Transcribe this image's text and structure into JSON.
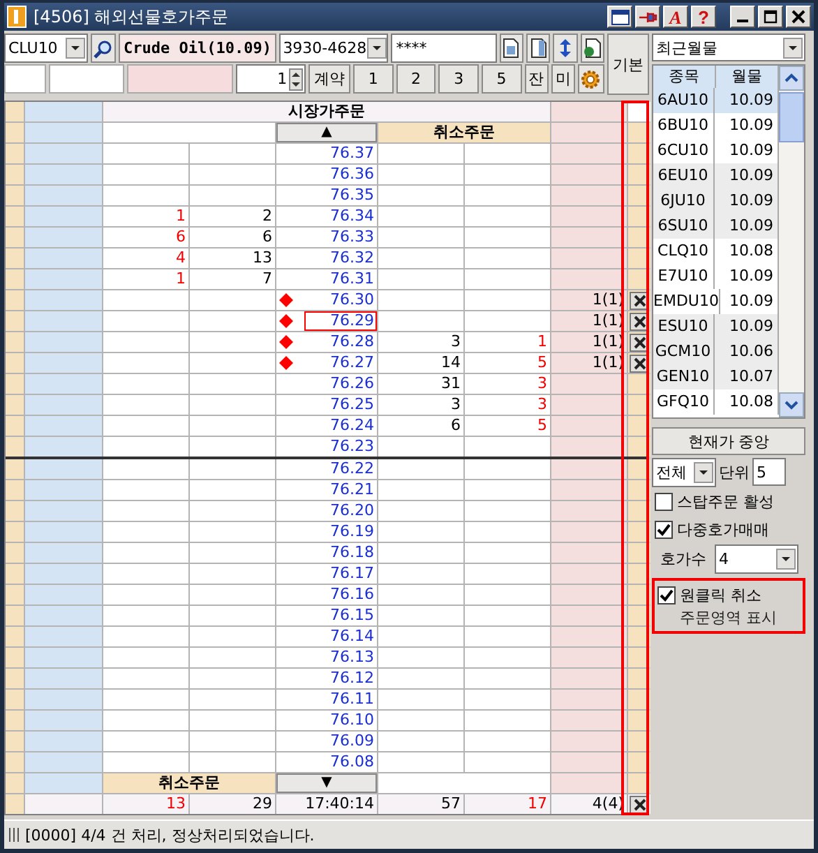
{
  "window": {
    "title": "[4506] 해외선물호가주문",
    "font_button": "A",
    "help_button": "?"
  },
  "toolbar": {
    "symbol": "CLU10",
    "instrument_name": "Crude Oil(10.09)",
    "account": "3930-4628",
    "password": "****",
    "quantity": "1",
    "quantity_button": "계약",
    "quick_quantities": [
      "1",
      "2",
      "3",
      "5"
    ],
    "balance_button": "잔",
    "unfilled_button": "미",
    "default_button": "기본"
  },
  "order_book": {
    "header": "시장가주문",
    "scroll_up": "▲",
    "cancel_header_top": "취소주문",
    "rows": [
      {
        "price": "76.37",
        "order_marker": false,
        "selected": false,
        "divider_below": false
      },
      {
        "price": "76.36",
        "order_marker": false,
        "selected": false,
        "divider_below": false
      },
      {
        "price": "76.35",
        "order_marker": false,
        "selected": false,
        "divider_below": false
      },
      {
        "price": "76.34",
        "column_2": "1",
        "column_3": "2",
        "order_marker": false,
        "selected": false,
        "divider_below": false
      },
      {
        "price": "76.33",
        "column_2": "6",
        "column_3": "6",
        "order_marker": false,
        "selected": false,
        "divider_below": false
      },
      {
        "price": "76.32",
        "column_2": "4",
        "column_3": "13",
        "order_marker": false,
        "selected": false,
        "divider_below": false
      },
      {
        "price": "76.31",
        "column_2": "1",
        "column_3": "7",
        "order_marker": false,
        "selected": false,
        "divider_below": false
      },
      {
        "price": "76.30",
        "orders": "1(1)",
        "order_marker": true,
        "selected": false,
        "divider_below": false
      },
      {
        "price": "76.29",
        "orders": "1(1)",
        "order_marker": true,
        "selected": true,
        "divider_below": false
      },
      {
        "price": "76.28",
        "column_5": "3",
        "column_6": "1",
        "orders": "1(1)",
        "order_marker": true,
        "selected": false,
        "divider_below": false
      },
      {
        "price": "76.27",
        "column_5": "14",
        "column_6": "5",
        "orders": "1(1)",
        "order_marker": true,
        "selected": false,
        "divider_below": false
      },
      {
        "price": "76.26",
        "column_5": "31",
        "column_6": "3",
        "order_marker": false,
        "selected": false,
        "divider_below": false
      },
      {
        "price": "76.25",
        "column_5": "3",
        "column_6": "3",
        "order_marker": false,
        "selected": false,
        "divider_below": false
      },
      {
        "price": "76.24",
        "column_5": "6",
        "column_6": "5",
        "order_marker": false,
        "selected": false,
        "divider_below": false
      },
      {
        "price": "76.23",
        "order_marker": false,
        "selected": false,
        "divider_below": true
      },
      {
        "price": "76.22",
        "order_marker": false,
        "selected": false,
        "divider_below": false
      },
      {
        "price": "76.21",
        "order_marker": false,
        "selected": false,
        "divider_below": false
      },
      {
        "price": "76.20",
        "order_marker": false,
        "selected": false,
        "divider_below": false
      },
      {
        "price": "76.19",
        "order_marker": false,
        "selected": false,
        "divider_below": false
      },
      {
        "price": "76.18",
        "order_marker": false,
        "selected": false,
        "divider_below": false
      },
      {
        "price": "76.17",
        "order_marker": false,
        "selected": false,
        "divider_below": false
      },
      {
        "price": "76.16",
        "order_marker": false,
        "selected": false,
        "divider_below": false
      },
      {
        "price": "76.15",
        "order_marker": false,
        "selected": false,
        "divider_below": false
      },
      {
        "price": "76.14",
        "order_marker": false,
        "selected": false,
        "divider_below": false
      },
      {
        "price": "76.13",
        "order_marker": false,
        "selected": false,
        "divider_below": false
      },
      {
        "price": "76.12",
        "order_marker": false,
        "selected": false,
        "divider_below": false
      },
      {
        "price": "76.11",
        "order_marker": false,
        "selected": false,
        "divider_below": false
      },
      {
        "price": "76.10",
        "order_marker": false,
        "selected": false,
        "divider_below": false
      },
      {
        "price": "76.09",
        "order_marker": false,
        "selected": false,
        "divider_below": false
      },
      {
        "price": "76.08",
        "order_marker": false,
        "selected": false,
        "divider_below": false
      }
    ],
    "cancel_header_bottom": "취소주문",
    "scroll_down": "▼",
    "totals": {
      "column_2": "13",
      "column_3": "29",
      "time": "17:40:14",
      "column_5": "57",
      "column_6": "17",
      "orders": "4(4)"
    }
  },
  "side_panel": {
    "month_select": "최근월물",
    "columns": [
      "종목",
      "월물"
    ],
    "contracts": [
      {
        "symbol": "6AU10",
        "month": "10.09",
        "selected": true
      },
      {
        "symbol": "6BU10",
        "month": "10.09",
        "selected": false
      },
      {
        "symbol": "6CU10",
        "month": "10.09",
        "selected": false
      },
      {
        "symbol": "6EU10",
        "month": "10.09",
        "selected": false
      },
      {
        "symbol": "6JU10",
        "month": "10.09",
        "selected": false
      },
      {
        "symbol": "6SU10",
        "month": "10.09",
        "selected": false
      },
      {
        "symbol": "CLQ10",
        "month": "10.08",
        "selected": false
      },
      {
        "symbol": "E7U10",
        "month": "10.09",
        "selected": false
      },
      {
        "symbol": "EMDU10",
        "month": "10.09",
        "selected": false
      },
      {
        "symbol": "ESU10",
        "month": "10.09",
        "selected": false
      },
      {
        "symbol": "GCM10",
        "month": "10.06",
        "selected": false
      },
      {
        "symbol": "GEN10",
        "month": "10.07",
        "selected": false
      },
      {
        "symbol": "GFQ10",
        "month": "10.08",
        "selected": false
      }
    ],
    "center_button": "현재가 중앙",
    "scope_select": "전체",
    "unit_label": "단위",
    "unit": "5",
    "options": [
      {
        "label": "스탑주문 활성",
        "checked": false
      },
      {
        "label": "다중호가매매",
        "checked": true
      }
    ],
    "depth_label": "호가수",
    "depth": "4",
    "one_click_cancel": {
      "label": "원클릭 취소",
      "checked": true
    },
    "note": "주문영역 표시"
  },
  "status_bar": {
    "message": "[0000] 4/4 건 처리, 정상처리되었습니다."
  }
}
